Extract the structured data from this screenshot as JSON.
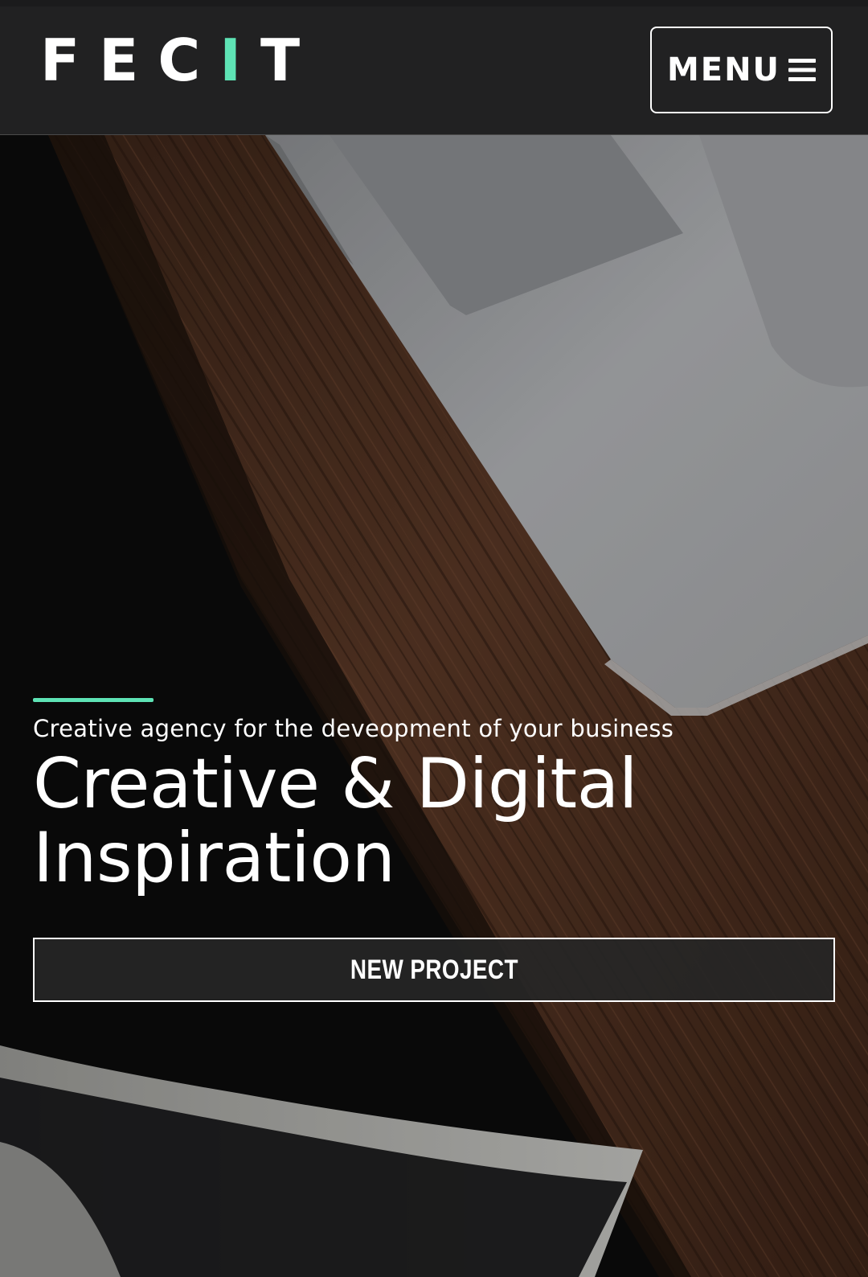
{
  "header": {
    "logo": {
      "prefix": "FEC",
      "accent_letter": "I",
      "suffix": "T"
    },
    "menu_label": "MENU",
    "menu_icon": "hamburger-icon"
  },
  "hero": {
    "tagline": "Creative agency for the deveopment of your business",
    "headline_line1": "Creative & Digital",
    "headline_line2": "Inspiration",
    "cta_label": "NEW PROJECT"
  },
  "colors": {
    "accent": "#5ee3b5",
    "header_bg": "#222223",
    "text": "#ffffff"
  }
}
